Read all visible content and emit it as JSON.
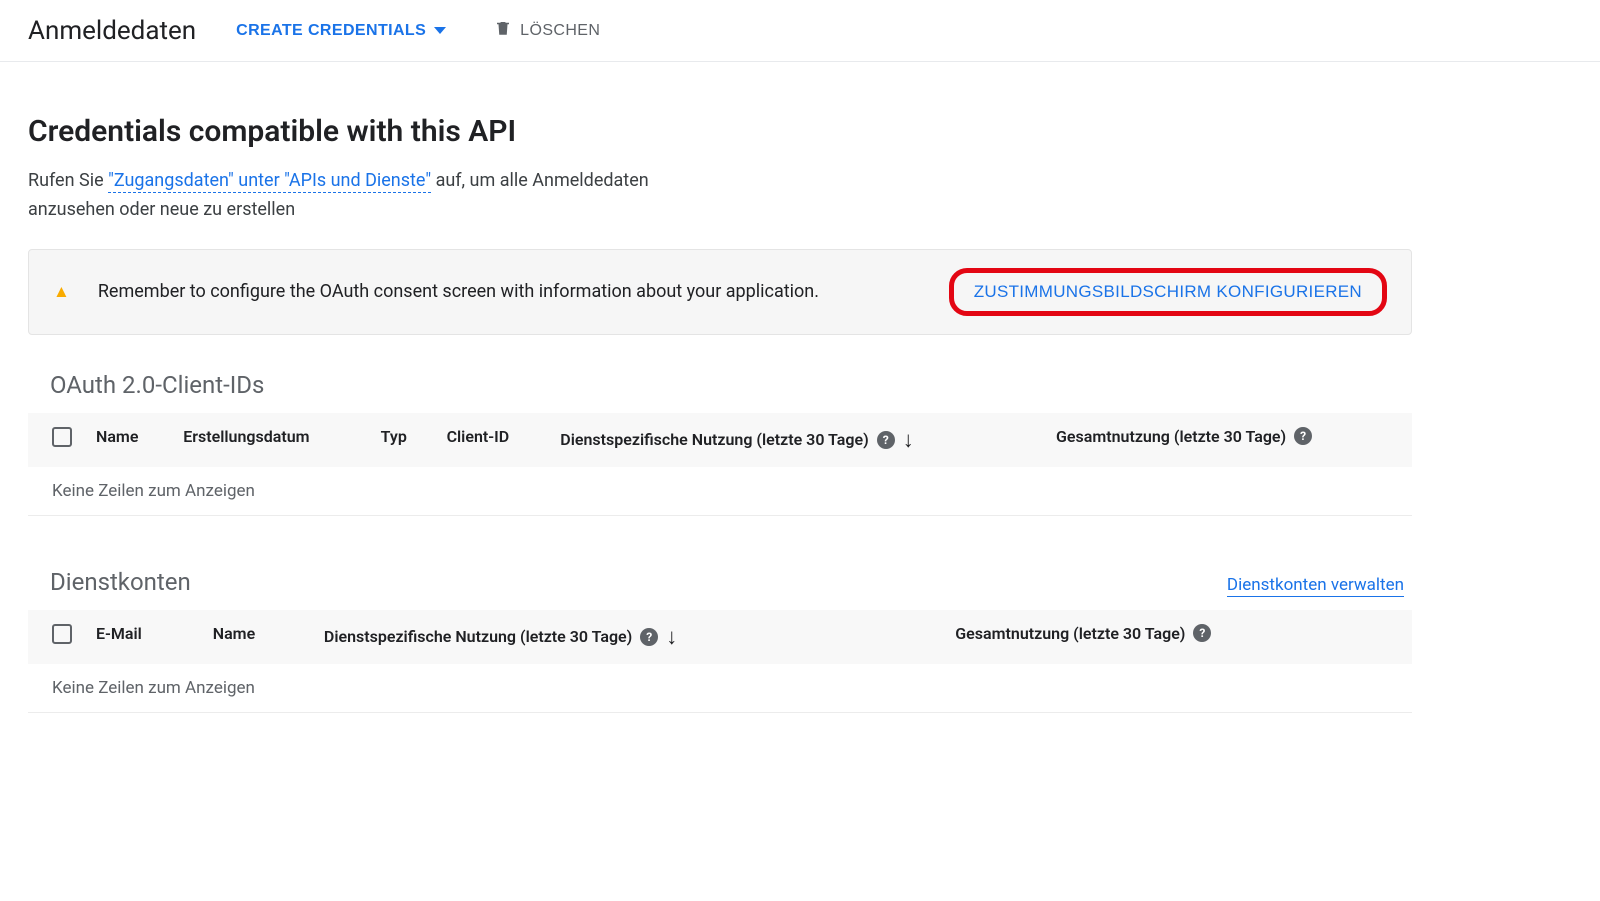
{
  "topbar": {
    "title": "Anmeldedaten",
    "create_label": "CREATE CREDENTIALS",
    "delete_label": "LÖSCHEN"
  },
  "intro": {
    "heading": "Credentials compatible with this API",
    "desc_prefix": "Rufen Sie ",
    "link_text": "\"Zugangsdaten\" unter \"APIs und Dienste\"",
    "desc_suffix": " auf, um alle Anmeldedaten anzusehen oder neue zu erstellen"
  },
  "banner": {
    "text": "Remember to configure the OAuth consent screen with information about your application.",
    "action_label": "ZUSTIMMUNGSBILDSCHIRM KONFIGURIEREN"
  },
  "oauth": {
    "title": "OAuth 2.0-Client-IDs",
    "columns": {
      "name": "Name",
      "created": "Erstellungsdatum",
      "type": "Typ",
      "client_id": "Client-ID",
      "service_usage": "Dienstspezifische Nutzung (letzte 30 Tage)",
      "total_usage": "Gesamtnutzung (letzte 30 Tage)"
    },
    "empty": "Keine Zeilen zum Anzeigen"
  },
  "service_accounts": {
    "title": "Dienstkonten",
    "manage_label": "Dienstkonten verwalten",
    "columns": {
      "email": "E-Mail",
      "name": "Name",
      "service_usage": "Dienstspezifische Nutzung (letzte 30 Tage)",
      "total_usage": "Gesamtnutzung (letzte 30 Tage)"
    },
    "empty": "Keine Zeilen zum Anzeigen"
  }
}
